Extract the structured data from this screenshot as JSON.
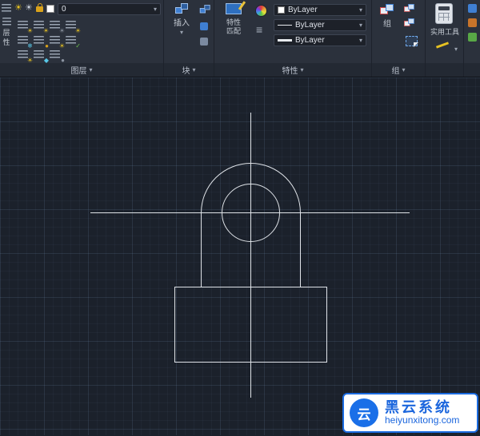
{
  "icons": {
    "caret_down": "▾",
    "sun": "☀",
    "snowflake": "❄",
    "check": "✓",
    "dot": "●",
    "diamond": "◆",
    "equiv_lines": "≡"
  },
  "ribbon": {
    "layers_panel": {
      "label": "图层",
      "layer_value": "0",
      "side_text_top": "层",
      "side_text_bottom": "性"
    },
    "block_panel": {
      "label": "块",
      "insert": "插入"
    },
    "properties_panel": {
      "label": "特性",
      "match_line1": "特性",
      "match_line2": "匹配",
      "color_value": "ByLayer",
      "linetype_value": "ByLayer",
      "lineweight_value": "ByLayer"
    },
    "group_panel": {
      "label": "组",
      "group_button": "组"
    },
    "utilities_panel": {
      "label": "实用工具"
    }
  },
  "watermark": {
    "logo_char": "云",
    "title": "黑云系统",
    "url": "heiyunxitong.com"
  },
  "colors": {
    "accent_blue": "#1b6be0",
    "canvas_line": "#dfe3e8"
  }
}
